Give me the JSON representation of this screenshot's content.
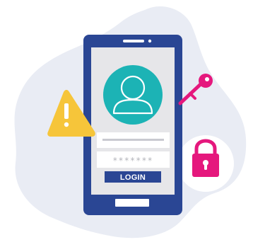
{
  "login_form": {
    "username_value": "",
    "password_mask": "*******",
    "login_label": "LOGIN"
  },
  "icons": {
    "user_avatar": "user-avatar-icon",
    "warning": "warning-icon",
    "key": "key-icon",
    "padlock": "padlock-icon"
  },
  "colors": {
    "phone_frame": "#2a4694",
    "screen": "#e6e6e9",
    "avatar_circle": "#1cb3b5",
    "login_button": "#2a4694",
    "warning": "#f6c53a",
    "key": "#e5187d",
    "padlock": "#e5187d",
    "blob": "#e9ecf4"
  }
}
